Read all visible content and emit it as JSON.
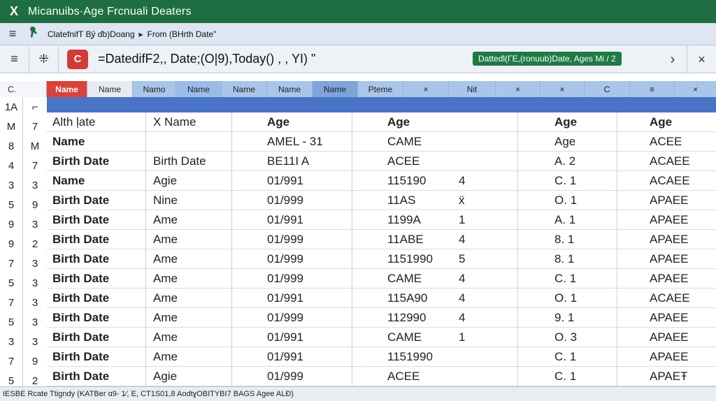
{
  "title_bar": {
    "app_icon": "X",
    "title": "Micanuibs·Age  Frcnuali Deaters"
  },
  "ribbon": {
    "menu_icon": "≡",
    "breadcrumb": "ClatefnifT B̧ŷ ɗb)Doang",
    "separator": "▸",
    "crumb_from": "From (BHrth Date\""
  },
  "formula_bar": {
    "menu_icon": "≡",
    "grid_icon": "⁜",
    "fx_label": "C",
    "formula": "=DatedifF2,, Date;(O|9),Today() , , YI) \"",
    "tag": "Datteɗl(ΓE,(ronuub)Date, Ages Mi / 2",
    "chevron": "›",
    "close": "×"
  },
  "column_header": {
    "corner": "C.",
    "cells": [
      {
        "label": "",
        "color": "#f4f6f9"
      },
      {
        "label": "Name",
        "color": "#d9423c",
        "text": "#ffffff"
      },
      {
        "label": "Name",
        "color": "#e7ebf1"
      },
      {
        "label": "Namo",
        "color": "#a9c5ea"
      },
      {
        "label": "Name",
        "color": "#9bbce8"
      },
      {
        "label": "Name",
        "color": "#a9c5ea"
      },
      {
        "label": "Name",
        "color": "#a9c5ea"
      },
      {
        "label": "Name",
        "color": "#7fa4dc"
      },
      {
        "label": "Pteme",
        "color": "#a9c5ea"
      },
      {
        "label": "×",
        "color": "#a9c5ea"
      },
      {
        "label": "Nit",
        "color": "#a9c5ea"
      },
      {
        "label": "×",
        "color": "#a9c5ea"
      },
      {
        "label": "×",
        "color": "#a9c5ea"
      },
      {
        "label": "C",
        "color": "#a9c5ea"
      },
      {
        "label": "≡",
        "color": "#a9c5ea"
      },
      {
        "label": "×",
        "color": "#a9c5ea"
      }
    ]
  },
  "row_index": [
    {
      "a": "1A",
      "b": "⌐"
    },
    {
      "a": "M",
      "b": "7"
    },
    {
      "a": "8",
      "b": "M"
    },
    {
      "a": "4",
      "b": "7"
    },
    {
      "a": "3",
      "b": "3"
    },
    {
      "a": "5",
      "b": "9"
    },
    {
      "a": "9",
      "b": "3"
    },
    {
      "a": "9",
      "b": "2"
    },
    {
      "a": "7",
      "b": "3"
    },
    {
      "a": "5",
      "b": "3"
    },
    {
      "a": "7",
      "b": "3"
    },
    {
      "a": "5",
      "b": "3"
    },
    {
      "a": "3",
      "b": "3"
    },
    {
      "a": "7",
      "b": "9"
    },
    {
      "a": "5",
      "b": "2"
    }
  ],
  "table": {
    "header": [
      "Alth ļate",
      "X Name",
      "Age",
      "Age",
      "Age",
      "Age"
    ],
    "rows": [
      [
        "Name",
        "",
        "AMEL - 31",
        "CAME",
        "",
        "Age",
        "ACEE"
      ],
      [
        "Birth Date",
        "Birth Date",
        "BE11I A",
        "ACEE",
        "",
        "A. 2",
        "ACAEE"
      ],
      [
        "Name",
        "Agie",
        "01/991",
        "115190",
        "4",
        "C. 1",
        "ACAEE"
      ],
      [
        "Birth Date",
        "Nine",
        "01/999",
        "11AS",
        "ẍ",
        "O. 1",
        "APAEE"
      ],
      [
        "Birth Date",
        "Ame",
        "01/991",
        "1199A",
        "1",
        "A. 1",
        "APAEE"
      ],
      [
        "Birth Date",
        "Ame",
        "01/999",
        "11ABE",
        "4",
        "8. 1",
        "APAEE"
      ],
      [
        "Birth Date",
        "Ame",
        "01/999",
        "1151990",
        "5",
        "8. 1",
        "APAEE"
      ],
      [
        "Birth Date",
        "Ame",
        "01/999",
        "CAME",
        "4",
        "C. 1",
        "APAEE"
      ],
      [
        "Birth Date",
        "Ame",
        "01/991",
        "115A90",
        "4",
        "O. 1",
        "ACAEE"
      ],
      [
        "Birth Date",
        "Ame",
        "01/999",
        "112990",
        "4",
        "9. 1",
        "APAEE"
      ],
      [
        "Birth Date",
        "Ame",
        "01/991",
        "CAME",
        "1",
        "O. 3",
        "APAEE"
      ],
      [
        "Birth Date",
        "Ame",
        "01/991",
        "1151990",
        "",
        "C. 1",
        "APAEE"
      ],
      [
        "Birth Date",
        "Agie",
        "01/999",
        "ACEE",
        "",
        "C. 1",
        "APAEŦ"
      ]
    ]
  },
  "status_bar": {
    "text": "IESBE  Rcate Ttigndy (KATBer ɑ9- 1⁄, E, CT1S01,8 AodtɣOBITYBI7 BAGS Agee ALĐ)"
  }
}
